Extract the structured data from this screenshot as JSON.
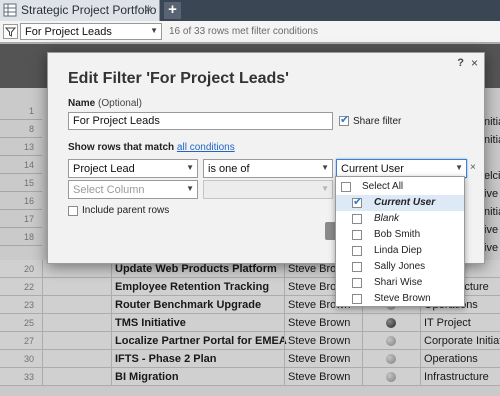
{
  "tab": {
    "title": "Strategic Project Portfolio",
    "close": "×",
    "add": "+"
  },
  "filter_bar": {
    "selected_filter": "For Project Leads",
    "status": "16 of 33 rows met filter conditions"
  },
  "rows_behind": [
    {
      "num": "1"
    },
    {
      "num": "8"
    },
    {
      "num": "13"
    },
    {
      "num": "14"
    },
    {
      "num": "15"
    },
    {
      "num": "16"
    },
    {
      "num": "17"
    },
    {
      "num": "18"
    }
  ],
  "edge_text": [
    "nitiative",
    "nitiative",
    "elci",
    "ive",
    "nitiative",
    "ive",
    "ive"
  ],
  "rows": [
    {
      "num": "20",
      "task": "Update Web Products Platform",
      "owner": "Steve Brown",
      "status": "",
      "category": ""
    },
    {
      "num": "22",
      "task": "Employee Retention Tracking",
      "owner": "Steve Brown",
      "status": "light",
      "category": "Infrastructure"
    },
    {
      "num": "23",
      "task": "Router Benchmark Upgrade",
      "owner": "Steve Brown",
      "status": "light",
      "category": "Operations"
    },
    {
      "num": "25",
      "task": "TMS Initiative",
      "owner": "Steve Brown",
      "status": "dark",
      "category": "IT Project"
    },
    {
      "num": "27",
      "task": "Localize Partner Portal for EMEA",
      "owner": "Steve Brown",
      "status": "light",
      "category": "Corporate Initiative"
    },
    {
      "num": "30",
      "task": "IFTS - Phase 2 Plan",
      "owner": "Steve Brown",
      "status": "light",
      "category": "Operations"
    },
    {
      "num": "33",
      "task": "BI Migration",
      "owner": "Steve Brown",
      "status": "light",
      "category": "Infrastructure"
    }
  ],
  "modal": {
    "help": "?",
    "close": "×",
    "title": "Edit Filter 'For Project Leads'",
    "name_label": "Name",
    "name_optional": "(Optional)",
    "name_value": "For Project Leads",
    "share_label": "Share filter",
    "share_checked": true,
    "match_prefix": "Show rows that match",
    "match_link": "all conditions",
    "condition": {
      "column": "Project Lead",
      "operator": "is one of",
      "value": "Current User",
      "remove": "×"
    },
    "new_condition": {
      "column_placeholder": "Select Column"
    },
    "include_parent_label": "Include parent rows"
  },
  "value_list": {
    "items": [
      {
        "label": "Select All",
        "checked": false,
        "style": "normal",
        "indent": false
      },
      {
        "label": "Current User",
        "checked": true,
        "style": "bold-italic",
        "indent": true
      },
      {
        "label": "Blank",
        "checked": false,
        "style": "italic",
        "indent": true
      },
      {
        "label": "Bob Smith",
        "checked": false,
        "style": "normal",
        "indent": true
      },
      {
        "label": "Linda Diep",
        "checked": false,
        "style": "normal",
        "indent": true
      },
      {
        "label": "Sally Jones",
        "checked": false,
        "style": "normal",
        "indent": true
      },
      {
        "label": "Shari Wise",
        "checked": false,
        "style": "normal",
        "indent": true
      },
      {
        "label": "Steve Brown",
        "checked": false,
        "style": "normal",
        "indent": true
      }
    ]
  },
  "colors": {
    "accent": "#1f64c8",
    "check": "#2a7dd1",
    "tabbar": "#3b4654"
  }
}
